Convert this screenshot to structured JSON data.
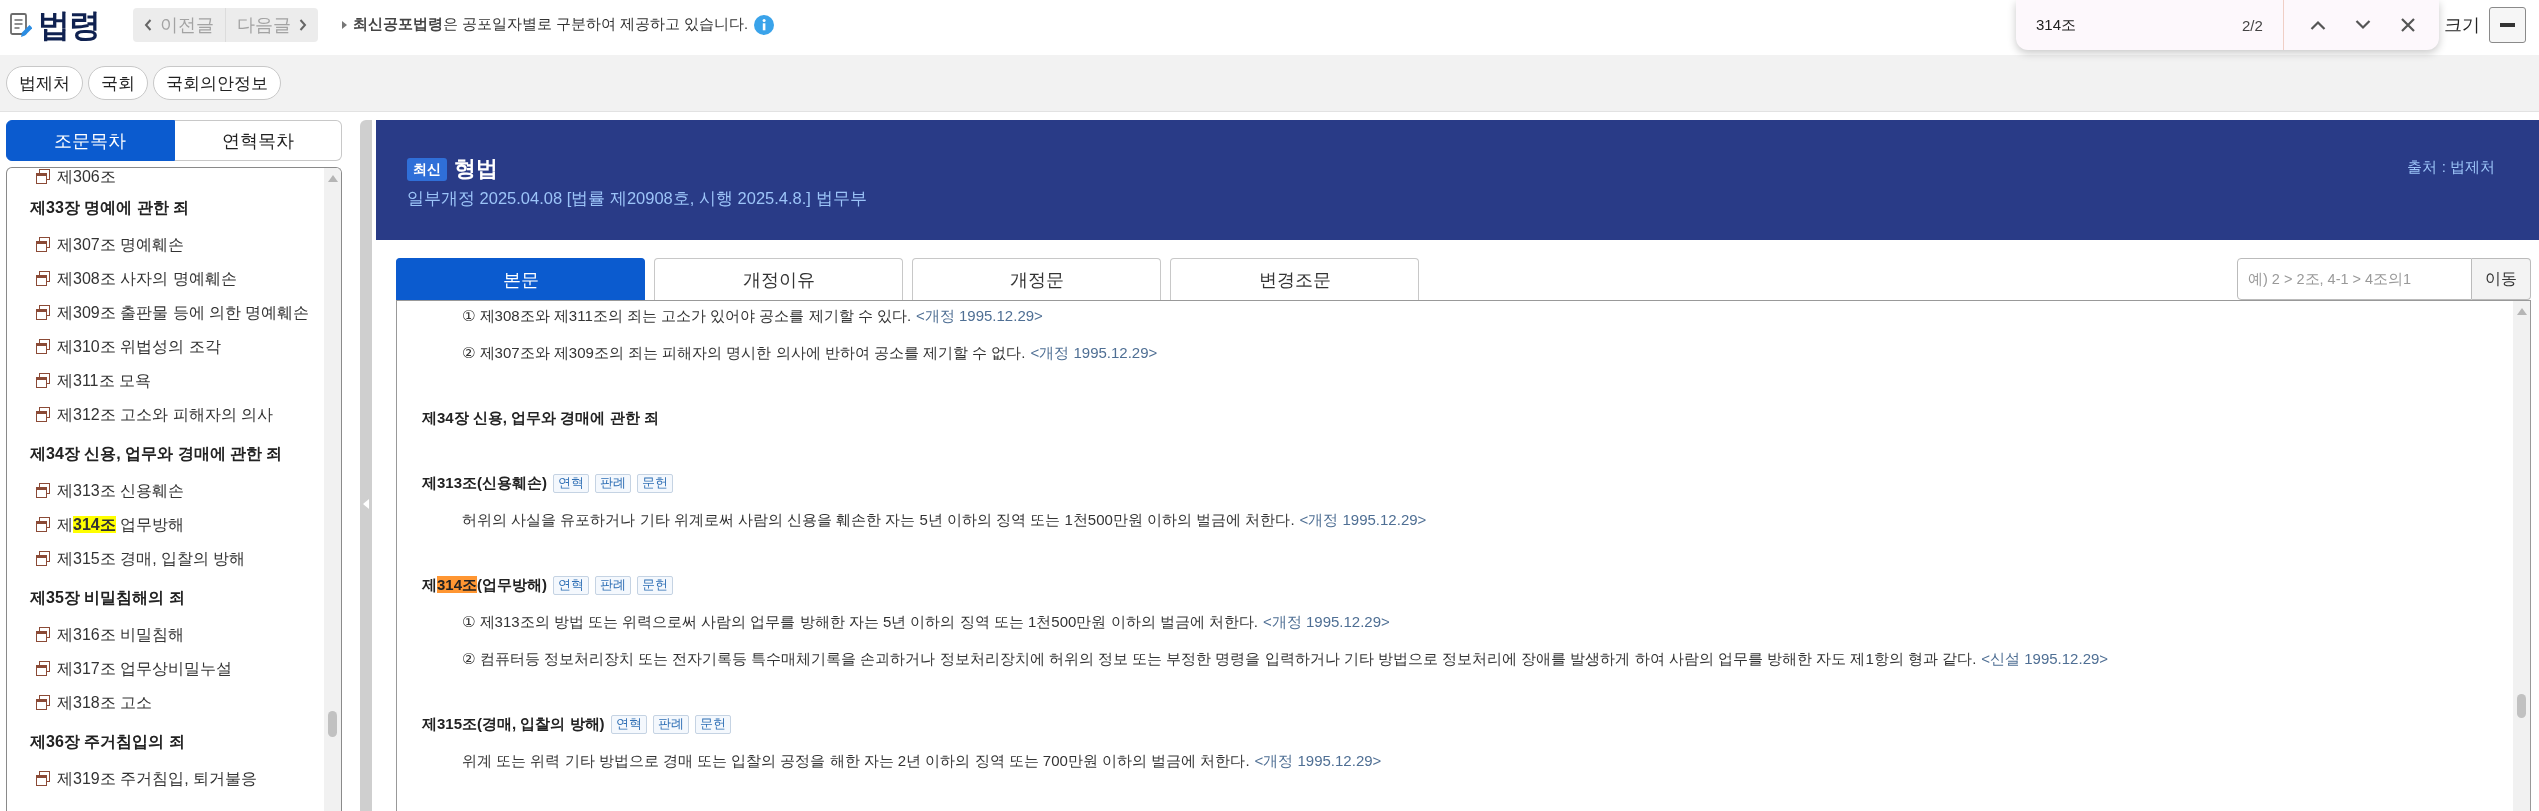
{
  "header": {
    "logo": "법령",
    "nav_buttons": [
      {
        "label": "이전글",
        "kind": "prev",
        "disabled": true
      },
      {
        "label": "다음글",
        "kind": "next",
        "disabled": true
      }
    ],
    "notice": "**최신공포법령**은 공포일자별로 구분하여 제공하고 있습니다.",
    "font_size_label": "크기"
  },
  "find_bar": {
    "query": "314조",
    "count": "2/2"
  },
  "link_bar": [
    "법제처",
    "국회",
    "국회의안정보"
  ],
  "sidebar": {
    "tabs": [
      {
        "label": "조문목차",
        "selected": true
      },
      {
        "label": "연혁목차",
        "selected": false
      }
    ],
    "toc": [
      {
        "kind": "article",
        "label": "제306조"
      },
      {
        "kind": "chapter",
        "label": "제33장 명예에 관한 죄",
        "children": [
          {
            "kind": "article",
            "label": "제307조 명예훼손"
          },
          {
            "kind": "article",
            "label": "제308조 사자의 명예훼손"
          },
          {
            "kind": "article",
            "label": "제309조 출판물 등에 의한 명예훼손"
          },
          {
            "kind": "article",
            "label": "제310조 위법성의 조각"
          },
          {
            "kind": "article",
            "label": "제311조 모욕"
          },
          {
            "kind": "article",
            "label": "제312조 고소와 피해자의 의사"
          }
        ]
      },
      {
        "kind": "chapter",
        "label": "제34장 신용, 업무와 경매에 관한 죄",
        "children": [
          {
            "kind": "article",
            "label": "제313조 신용훼손"
          },
          {
            "kind": "article",
            "segments": [
              {
                "text": "제",
                "highlighted": false,
                "current": false
              },
              {
                "text": "**314조**",
                "highlighted": true,
                "current": false
              },
              {
                "text": " 업무방해",
                "highlighted": false,
                "current": false
              }
            ]
          },
          {
            "kind": "article",
            "label": "제315조 경매, 입찰의 방해"
          }
        ]
      },
      {
        "kind": "chapter",
        "label": "제35장 비밀침해의 죄",
        "children": [
          {
            "kind": "article",
            "label": "제316조 비밀침해"
          },
          {
            "kind": "article",
            "label": "제317조 업무상비밀누설"
          },
          {
            "kind": "article",
            "label": "제318조 고소"
          }
        ]
      },
      {
        "kind": "chapter",
        "label": "제36장 주거침입의 죄",
        "children": [
          {
            "kind": "article",
            "label": "제319조 주거침입, 퇴거불응"
          }
        ]
      }
    ]
  },
  "law": {
    "badge": "최신",
    "title": "형법",
    "subtitle": "일부개정 2025.04.08 [법률 제20908호, 시행 2025.4.8.] 법무부",
    "source": "출처 : 법제처",
    "tabs": [
      {
        "label": "본문",
        "selected": true
      },
      {
        "label": "개정이유",
        "selected": false
      },
      {
        "label": "개정문",
        "selected": false
      },
      {
        "label": "변경조문",
        "selected": false
      }
    ],
    "jump": {
      "placeholder": "예) 2 > 2조, 4-1 > 4조의1",
      "button": "이동"
    },
    "blocks": [
      {
        "kind": "clause",
        "text": "① 제308조와 제311조의 죄는 고소가 있어야 공소를 제기할 수 있다.",
        "note": "<개정 1995.12.29>"
      },
      {
        "kind": "clause",
        "text": "② 제307조와 제309조의 죄는 피해자의 명시한 의사에 반하여 공소를 제기할 수 없다.",
        "note": "<개정 1995.12.29>"
      },
      {
        "kind": "chapter",
        "text": "제34장 신용, 업무와 경매에 관한 죄"
      },
      {
        "kind": "article",
        "title": [
          {
            "text": "제313조(신용훼손)",
            "highlighted": false,
            "current": false
          }
        ],
        "tags": [
          "연혁",
          "판례",
          "문헌"
        ],
        "clauses": [
          {
            "text": "허위의 사실을 유포하거나 기타 위계로써 사람의 신용을 훼손한 자는 5년 이하의 징역 또는 1천500만원 이하의 벌금에 처한다.",
            "note": "<개정 1995.12.29>"
          }
        ]
      },
      {
        "kind": "article",
        "title": [
          {
            "text": "제",
            "highlighted": false,
            "current": false
          },
          {
            "text": "314조",
            "highlighted": true,
            "current": true
          },
          {
            "text": "(업무방해)",
            "highlighted": false,
            "current": false
          }
        ],
        "tags": [
          "연혁",
          "판례",
          "문헌"
        ],
        "clauses": [
          {
            "text": "① 제313조의 방법 또는 위력으로써 사람의 업무를 방해한 자는 5년 이하의 징역 또는 1천500만원 이하의 벌금에 처한다.",
            "note": "<개정 1995.12.29>"
          },
          {
            "text": "② 컴퓨터등 정보처리장치 또는 전자기록등 특수매체기록을 손괴하거나 정보처리장치에 허위의 정보 또는 부정한 명령을 입력하거나 기타 방법으로 정보처리에 장애를 발생하게 하여 사람의 업무를 방해한 자도 제1항의 형과 같다.",
            "note": "<신설 1995.12.29>"
          }
        ]
      },
      {
        "kind": "article",
        "title": [
          {
            "text": "제315조(경매, 입찰의 방해)",
            "highlighted": false,
            "current": false
          }
        ],
        "tags": [
          "연혁",
          "판례",
          "문헌"
        ],
        "clauses": [
          {
            "text": "위계 또는 위력 기타 방법으로 경매 또는 입찰의 공정을 해한 자는 2년 이하의 징역 또는 700만원 이하의 벌금에 처한다.",
            "note": "<개정 1995.12.29>"
          }
        ]
      }
    ]
  }
}
